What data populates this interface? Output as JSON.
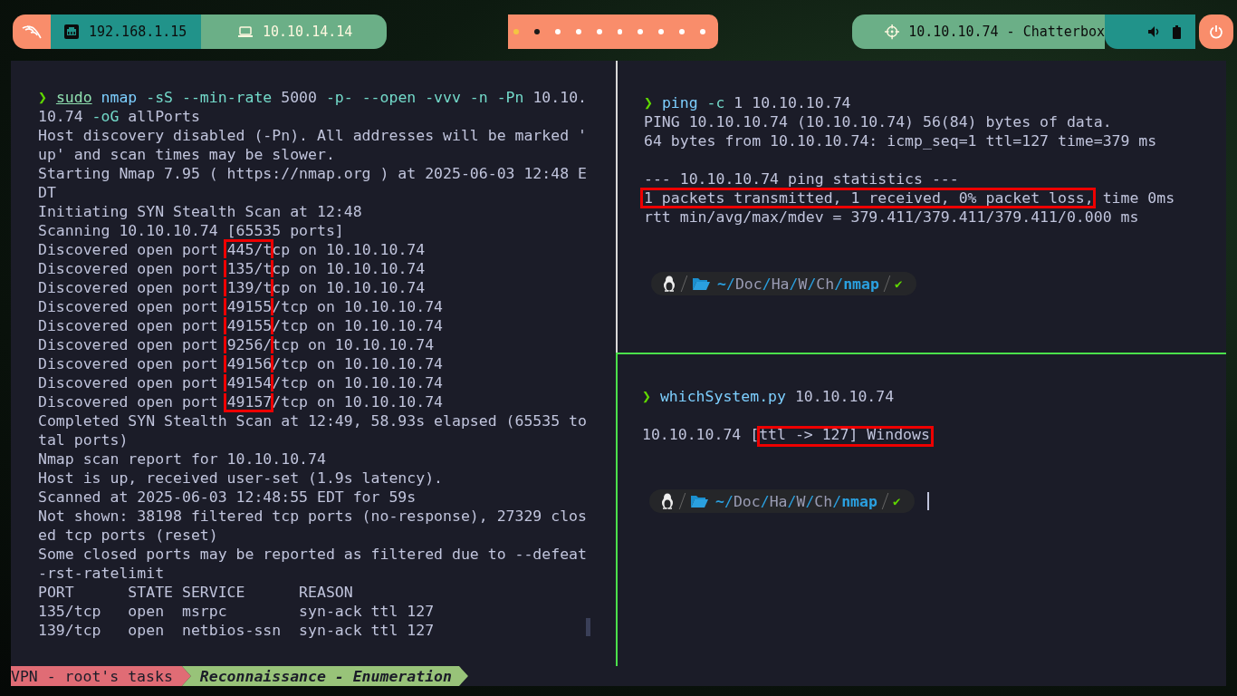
{
  "top_bar": {
    "launcher": {
      "kind": "dragon"
    },
    "chips": [
      {
        "kind": "ethernet",
        "label": "192.168.1.15",
        "color": "#21938a"
      },
      {
        "kind": "laptop",
        "label": "10.10.14.14",
        "color": "#6baf87"
      }
    ],
    "workspaces": [
      {
        "selected": true,
        "occupied": true
      },
      {
        "selected": false,
        "occupied": true
      },
      {
        "selected": false,
        "occupied": false
      },
      {
        "selected": false,
        "occupied": false
      },
      {
        "selected": false,
        "occupied": false
      },
      {
        "selected": false,
        "occupied": false
      },
      {
        "selected": false,
        "occupied": false
      },
      {
        "selected": false,
        "occupied": false
      },
      {
        "selected": false,
        "occupied": false
      },
      {
        "selected": false,
        "occupied": false
      }
    ],
    "target": {
      "label": "10.10.10.74 - Chatterbox"
    },
    "tray": [
      {
        "kind": "volume"
      },
      {
        "kind": "battery"
      }
    ],
    "power": {
      "kind": "power"
    }
  },
  "panes": [
    {
      "active": false,
      "lines": [
        {
          "kind": "text",
          "segments": [
            {
              "text": "❯ ",
              "kind": "prompt"
            },
            {
              "text": "sudo",
              "kind": "builtin"
            },
            {
              "text": " nmap",
              "kind": "program"
            },
            {
              "text": " -sS --min-rate",
              "kind": "option"
            },
            {
              "text": " 5000",
              "kind": "plain"
            },
            {
              "text": " -p- --open -vvv -n -Pn",
              "kind": "option"
            },
            {
              "text": " 10.10.",
              "kind": "plain"
            }
          ]
        },
        {
          "kind": "text",
          "segments": [
            {
              "text": "10.74",
              "kind": "plain"
            },
            {
              "text": " -oG",
              "kind": "option"
            },
            {
              "text": " allPorts",
              "kind": "plain"
            }
          ]
        },
        {
          "kind": "text",
          "segments": [
            {
              "text": "Host discovery disabled (-Pn). All addresses will be marked '",
              "kind": "plain"
            }
          ]
        },
        {
          "kind": "text",
          "segments": [
            {
              "text": "up' and scan times may be slower.",
              "kind": "plain"
            }
          ]
        },
        {
          "kind": "text",
          "segments": [
            {
              "text": "Starting Nmap 7.95 ( https://nmap.org ) at 2025-06-03 12:48 E",
              "kind": "plain"
            }
          ]
        },
        {
          "kind": "text",
          "segments": [
            {
              "text": "DT",
              "kind": "plain"
            }
          ]
        },
        {
          "kind": "text",
          "segments": [
            {
              "text": "Initiating SYN Stealth Scan at 12:48",
              "kind": "plain"
            }
          ]
        },
        {
          "kind": "text",
          "segments": [
            {
              "text": "Scanning 10.10.10.74 [65535 ports]",
              "kind": "plain"
            }
          ]
        },
        {
          "kind": "text",
          "segments": [
            {
              "text": "Discovered open port ",
              "kind": "plain"
            },
            {
              "text": "445/",
              "kind": "plain",
              "highlighted": true
            },
            {
              "text": "tcp on 10.10.10.74",
              "kind": "plain"
            }
          ]
        },
        {
          "kind": "text",
          "segments": [
            {
              "text": "Discovered open port ",
              "kind": "plain"
            },
            {
              "text": "135/",
              "kind": "plain",
              "highlighted": true
            },
            {
              "text": "tcp on 10.10.10.74",
              "kind": "plain"
            }
          ]
        },
        {
          "kind": "text",
          "segments": [
            {
              "text": "Discovered open port ",
              "kind": "plain"
            },
            {
              "text": "139/",
              "kind": "plain",
              "highlighted": true
            },
            {
              "text": "tcp on 10.10.10.74",
              "kind": "plain"
            }
          ]
        },
        {
          "kind": "text",
          "segments": [
            {
              "text": "Discovered open port ",
              "kind": "plain"
            },
            {
              "text": "49155",
              "kind": "plain",
              "highlighted": true
            },
            {
              "text": "/tcp on 10.10.10.74",
              "kind": "plain"
            }
          ]
        },
        {
          "kind": "text",
          "segments": [
            {
              "text": "Discovered open port ",
              "kind": "plain"
            },
            {
              "text": "49155",
              "kind": "plain",
              "highlighted": true
            },
            {
              "text": "/tcp on 10.10.10.74",
              "kind": "plain"
            }
          ]
        },
        {
          "kind": "text",
          "segments": [
            {
              "text": "Discovered open port ",
              "kind": "plain"
            },
            {
              "text": "9256/",
              "kind": "plain",
              "highlighted": true
            },
            {
              "text": "tcp on 10.10.10.74",
              "kind": "plain"
            }
          ]
        },
        {
          "kind": "text",
          "segments": [
            {
              "text": "Discovered open port ",
              "kind": "plain"
            },
            {
              "text": "49156",
              "kind": "plain",
              "highlighted": true
            },
            {
              "text": "/tcp on 10.10.10.74",
              "kind": "plain"
            }
          ]
        },
        {
          "kind": "text",
          "segments": [
            {
              "text": "Discovered open port ",
              "kind": "plain"
            },
            {
              "text": "49154",
              "kind": "plain",
              "highlighted": true
            },
            {
              "text": "/tcp on 10.10.10.74",
              "kind": "plain"
            }
          ]
        },
        {
          "kind": "text",
          "segments": [
            {
              "text": "Discovered open port ",
              "kind": "plain"
            },
            {
              "text": "49157",
              "kind": "plain",
              "highlighted": true
            },
            {
              "text": "/tcp on 10.10.10.74",
              "kind": "plain"
            }
          ]
        },
        {
          "kind": "text",
          "segments": [
            {
              "text": "Completed SYN Stealth Scan at 12:49, 58.93s elapsed (65535 to",
              "kind": "plain"
            }
          ]
        },
        {
          "kind": "text",
          "segments": [
            {
              "text": "tal ports)",
              "kind": "plain"
            }
          ]
        },
        {
          "kind": "text",
          "segments": [
            {
              "text": "Nmap scan report for 10.10.10.74",
              "kind": "plain"
            }
          ]
        },
        {
          "kind": "text",
          "segments": [
            {
              "text": "Host is up, received user-set (1.9s latency).",
              "kind": "plain"
            }
          ]
        },
        {
          "kind": "text",
          "segments": [
            {
              "text": "Scanned at 2025-06-03 12:48:55 EDT for 59s",
              "kind": "plain"
            }
          ]
        },
        {
          "kind": "text",
          "segments": [
            {
              "text": "Not shown: 38198 filtered tcp ports (no-response), 27329 clos",
              "kind": "plain"
            }
          ]
        },
        {
          "kind": "text",
          "segments": [
            {
              "text": "ed tcp ports (reset)",
              "kind": "plain"
            }
          ]
        },
        {
          "kind": "text",
          "segments": [
            {
              "text": "Some closed ports may be reported as filtered due to --defeat",
              "kind": "plain"
            }
          ]
        },
        {
          "kind": "text",
          "segments": [
            {
              "text": "-rst-ratelimit",
              "kind": "plain"
            }
          ]
        },
        {
          "kind": "text",
          "segments": [
            {
              "text": "PORT      STATE SERVICE      REASON",
              "kind": "plain"
            }
          ]
        },
        {
          "kind": "text",
          "segments": [
            {
              "text": "135/tcp   open  msrpc        syn-ack ttl 127",
              "kind": "plain"
            }
          ]
        },
        {
          "kind": "text",
          "segments": [
            {
              "text": "139/tcp   open  netbios-ssn  syn-ack ttl 127",
              "kind": "plain"
            }
          ]
        }
      ]
    },
    {
      "active": false,
      "lines": [
        {
          "kind": "text",
          "segments": [
            {
              "text": "❯ ",
              "kind": "prompt"
            },
            {
              "text": "ping",
              "kind": "program"
            },
            {
              "text": " -c",
              "kind": "option"
            },
            {
              "text": " 1 10.10.10.74",
              "kind": "plain"
            }
          ]
        },
        {
          "kind": "text",
          "segments": [
            {
              "text": "PING 10.10.10.74 (10.10.10.74) 56(84) bytes of data.",
              "kind": "plain"
            }
          ]
        },
        {
          "kind": "text",
          "segments": [
            {
              "text": "64 bytes from 10.10.10.74: icmp_seq=1 ttl=127 time=379 ms",
              "kind": "plain"
            }
          ]
        },
        {
          "kind": "blank"
        },
        {
          "kind": "text",
          "segments": [
            {
              "text": "--- 10.10.10.74 ping statistics ---",
              "kind": "plain"
            }
          ]
        },
        {
          "kind": "text",
          "segments": [
            {
              "text": "1 packets transmitted, 1 received, 0% packet loss,",
              "kind": "plain",
              "highlighted": true
            },
            {
              "text": " time 0ms",
              "kind": "plain"
            }
          ]
        },
        {
          "kind": "text",
          "segments": [
            {
              "text": "rtt min/avg/max/mdev = 379.411/379.411/379.411/0.000 ms",
              "kind": "plain"
            }
          ]
        },
        {
          "kind": "blank"
        },
        {
          "kind": "blank"
        },
        {
          "kind": "powerline",
          "path": [
            {
              "text": "~",
              "kind": "home"
            },
            {
              "text": "/",
              "kind": "sep"
            },
            {
              "text": "Doc",
              "kind": "dir"
            },
            {
              "text": "/",
              "kind": "sep"
            },
            {
              "text": "Ha",
              "kind": "dir"
            },
            {
              "text": "/",
              "kind": "sep"
            },
            {
              "text": "W",
              "kind": "dir"
            },
            {
              "text": "/",
              "kind": "sep"
            },
            {
              "text": "Ch",
              "kind": "dir"
            },
            {
              "text": "/",
              "kind": "sep"
            },
            {
              "text": "nmap",
              "kind": "current"
            }
          ],
          "status": "✔",
          "cursor": false
        }
      ]
    },
    {
      "active": true,
      "lines": [
        {
          "kind": "text",
          "segments": [
            {
              "text": "❯ ",
              "kind": "prompt"
            },
            {
              "text": "whichSystem.py",
              "kind": "program"
            },
            {
              "text": " 10.10.10.74",
              "kind": "plain"
            }
          ]
        },
        {
          "kind": "blank"
        },
        {
          "kind": "text",
          "segments": [
            {
              "text": "10.10.10.74 [",
              "kind": "plain"
            },
            {
              "text": "ttl -> 127] Windows",
              "kind": "plain",
              "highlighted": true
            }
          ]
        },
        {
          "kind": "blank"
        },
        {
          "kind": "blank"
        },
        {
          "kind": "powerline",
          "path": [
            {
              "text": "~",
              "kind": "home"
            },
            {
              "text": "/",
              "kind": "sep"
            },
            {
              "text": "Doc",
              "kind": "dir"
            },
            {
              "text": "/",
              "kind": "sep"
            },
            {
              "text": "Ha",
              "kind": "dir"
            },
            {
              "text": "/",
              "kind": "sep"
            },
            {
              "text": "W",
              "kind": "dir"
            },
            {
              "text": "/",
              "kind": "sep"
            },
            {
              "text": "Ch",
              "kind": "dir"
            },
            {
              "text": "/",
              "kind": "sep"
            },
            {
              "text": "nmap",
              "kind": "current"
            }
          ],
          "status": "✔",
          "cursor": true
        }
      ]
    }
  ],
  "status_bar": {
    "session": "VPN - root's tasks",
    "window": "Reconnaissance - Enumeration"
  }
}
